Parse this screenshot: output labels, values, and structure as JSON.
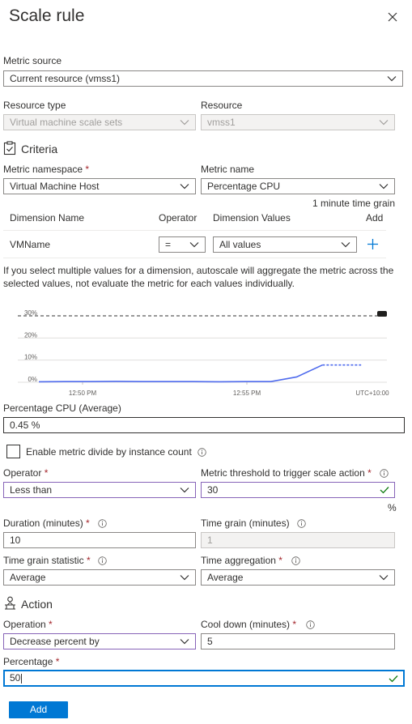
{
  "panel": {
    "title": "Scale rule"
  },
  "metric_source": {
    "label": "Metric source",
    "value": "Current resource (vmss1)"
  },
  "resource_type": {
    "label": "Resource type",
    "value": "Virtual machine scale sets"
  },
  "resource": {
    "label": "Resource",
    "value": "vmss1"
  },
  "criteria": {
    "heading": "Criteria"
  },
  "metric_namespace": {
    "label": "Metric namespace",
    "value": "Virtual Machine Host"
  },
  "metric_name": {
    "label": "Metric name",
    "value": "Percentage CPU",
    "time_grain_note": "1 minute time grain"
  },
  "dimensions": {
    "headers": {
      "name": "Dimension Name",
      "operator": "Operator",
      "values": "Dimension Values",
      "add": "Add"
    },
    "row": {
      "name": "VMName",
      "operator": "=",
      "values": "All values"
    },
    "note": "If you select multiple values for a dimension, autoscale will aggregate the metric across the selected values, not evaluate the metric for each values individually."
  },
  "chart_data": {
    "type": "line",
    "y_ticks": [
      "30%",
      "20%",
      "10%",
      "0%"
    ],
    "ylim": [
      0,
      30
    ],
    "x_ticks": [
      "12:50 PM",
      "12:55 PM",
      "UTC+10:00"
    ],
    "threshold": 30,
    "series": [
      {
        "x": [
          0,
          1,
          2,
          3,
          4,
          5,
          6,
          7,
          8,
          9,
          10,
          11
        ],
        "values": [
          0.2,
          0.3,
          0.3,
          0.4,
          0.3,
          0.3,
          0.3,
          0.2,
          0.3,
          0.3,
          2.4,
          7.8
        ]
      }
    ],
    "projection": {
      "from": 11,
      "to": 12.5,
      "value": 7.8
    },
    "grid": true
  },
  "current_value": {
    "label": "Percentage CPU (Average)",
    "value": "0.45 %"
  },
  "divide_checkbox": {
    "label": "Enable metric divide by instance count",
    "checked": false
  },
  "operator": {
    "label": "Operator",
    "value": "Less than"
  },
  "threshold": {
    "label": "Metric threshold to trigger scale action",
    "value": "30",
    "unit": "%"
  },
  "duration": {
    "label": "Duration (minutes)",
    "value": "10"
  },
  "time_grain": {
    "label": "Time grain (minutes)",
    "value": "1"
  },
  "time_grain_statistic": {
    "label": "Time grain statistic",
    "value": "Average"
  },
  "time_aggregation": {
    "label": "Time aggregation",
    "value": "Average"
  },
  "action": {
    "heading": "Action"
  },
  "operation": {
    "label": "Operation",
    "value": "Decrease percent by"
  },
  "cool_down": {
    "label": "Cool down (minutes)",
    "value": "5"
  },
  "percentage": {
    "label": "Percentage",
    "value": "50"
  },
  "footer": {
    "add_label": "Add"
  },
  "colors": {
    "accent": "#0078d4",
    "valid": "#107c10",
    "purple_border": "#8764b8",
    "required": "#a4262c",
    "series": "#4f6bed"
  }
}
